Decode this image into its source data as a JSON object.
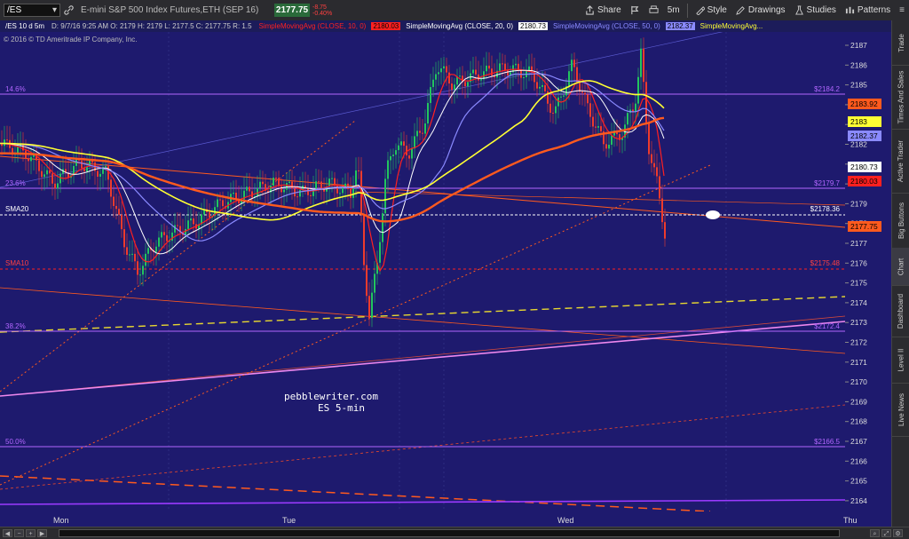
{
  "toolbar": {
    "symbol": "/ES",
    "description": "E-mini S&P 500 Index Futures,ETH (SEP 16)",
    "last_price": "2177.75",
    "change": "-8.75",
    "change_pct": "-0.40%",
    "share_label": "Share",
    "timeframe_label": "5m",
    "style_label": "Style",
    "drawings_label": "Drawings",
    "studies_label": "Studies",
    "patterns_label": "Patterns"
  },
  "infobar": {
    "title": "/ES 10 d 5m",
    "ohlc": "D: 9/7/16 9:25 AM   O: 2179   H: 2179   L: 2177.5   C: 2177.75   R: 1.5",
    "sma10_label": "SimpleMovingAvg (CLOSE, 10, 0)",
    "sma10_value": "2180.03",
    "sma20_label": "SimpleMovingAvg (CLOSE, 20, 0)",
    "sma20_value": "2180.73",
    "sma50_label": "SimpleMovingAvg (CLOSE, 50, 0)",
    "sma50_value": "2182.37",
    "sma100_label": "SimpleMovingAvg...",
    "copyright": "© 2016 © TD Ameritrade IP Company, Inc."
  },
  "chart": {
    "watermark_line1": "pebblewriter.com",
    "watermark_line2": "ES 5-min",
    "day_labels": [
      "Mon",
      "Tue",
      "Wed",
      "Thu"
    ],
    "price_ticks": [
      "2187",
      "2186",
      "2185",
      "2184",
      "2183",
      "2182",
      "2181",
      "2180",
      "2179",
      "2178",
      "2177",
      "2176",
      "2175",
      "2174",
      "2173",
      "2172",
      "2171",
      "2170",
      "2169",
      "2168",
      "2167",
      "2166",
      "2165",
      "2164"
    ],
    "fib_levels": [
      {
        "label": "14.6%",
        "value_label": "$2184.2"
      },
      {
        "label": "23.6%",
        "value_label": "$2179.7"
      },
      {
        "label": "38.2%",
        "value_label": "$2172.4"
      },
      {
        "label": "50.0%",
        "value_label": "$2166.5"
      }
    ],
    "sma20_line": {
      "label": "SMA20",
      "value_label": "$2178.36"
    },
    "sma10_line": {
      "label": "SMA10",
      "value_label": "$2175.48"
    },
    "price_bubbles": [
      {
        "value": "2183.92",
        "color": "#ff5a1e"
      },
      {
        "value": "2183",
        "color": "#ffff33"
      },
      {
        "value": "2182.37",
        "color": "#8a8aff"
      },
      {
        "value": "2180.73",
        "color": "#ffffff"
      },
      {
        "value": "2180.03",
        "color": "#ff2020"
      },
      {
        "value": "2177.75",
        "color": "#ff5a1e"
      }
    ],
    "colors": {
      "background": "#1e1a6e",
      "bull_candle": "#22c55e",
      "bear_candle": "#ef3b2c",
      "fib_line": "#b266ff",
      "sma10": "#ff2020",
      "sma20": "#ffffff",
      "sma50": "#8a8aff",
      "sma100": "#ffff33",
      "sma200": "#ff5a1e"
    }
  },
  "sidepanel": {
    "tabs": [
      "Trade",
      "Times And Sales",
      "Active Trader",
      "Big Buttons",
      "Chart",
      "Dashboard",
      "Level II",
      "Live News"
    ]
  }
}
